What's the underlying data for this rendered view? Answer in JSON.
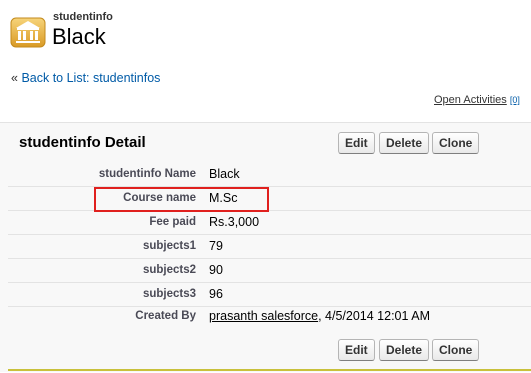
{
  "header": {
    "object_type": "studentinfo",
    "record_name": "Black",
    "logo_icon": "building-icon"
  },
  "nav": {
    "back_prefix": "« ",
    "back_link": "Back to List: studentinfos",
    "related_link": "Open Activities",
    "related_count": "[0]"
  },
  "detail": {
    "title": "studentinfo Detail",
    "buttons": {
      "edit": "Edit",
      "delete": "Delete",
      "clone": "Clone"
    },
    "fields": [
      {
        "label": "studentinfo Name",
        "value": "Black"
      },
      {
        "label": "Course name",
        "value": "M.Sc"
      },
      {
        "label": "Fee paid",
        "value": "Rs.3,000"
      },
      {
        "label": "subjects1",
        "value": "79"
      },
      {
        "label": "subjects2",
        "value": "90"
      },
      {
        "label": "subjects3",
        "value": "96"
      }
    ],
    "created_by": {
      "label": "Created By",
      "user": "prasanth salesforce",
      "date": ", 4/5/2014 12:01 AM"
    }
  },
  "colors": {
    "highlight": "#e0201e",
    "accent_rule": "#c9c13b",
    "link": "#015ba7"
  }
}
